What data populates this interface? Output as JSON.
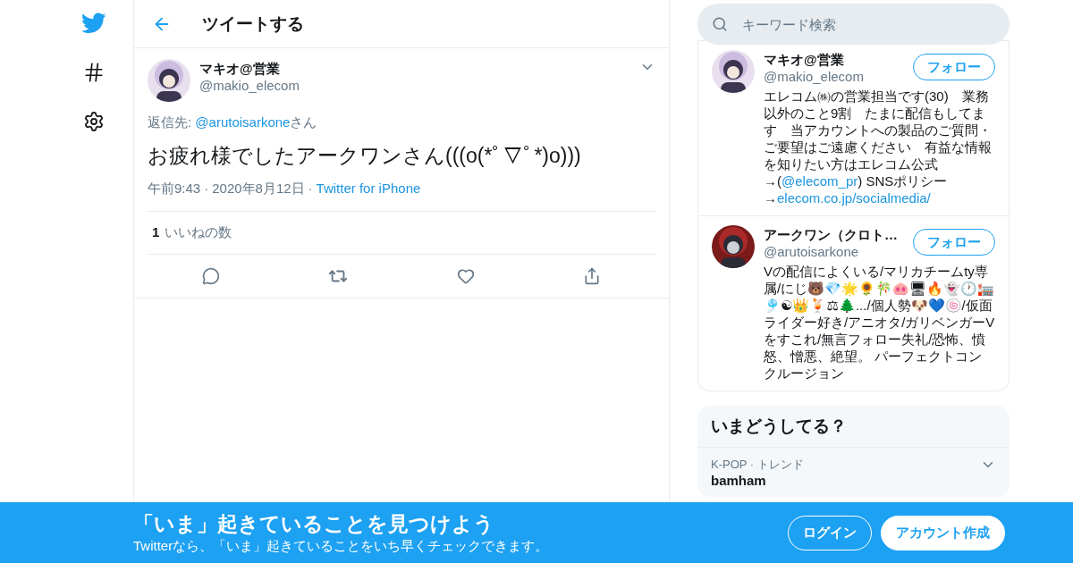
{
  "nav": {
    "items": [
      {
        "kind": "logo"
      },
      {
        "kind": "explore"
      },
      {
        "kind": "settings"
      }
    ]
  },
  "header": {
    "title": "ツイートする"
  },
  "tweet": {
    "name": "マキオ@営業",
    "handle": "@makio_elecom",
    "reply_label": "返信先:",
    "reply_to": "@arutoisarkone",
    "reply_suffix": "さん",
    "text": "お疲れ様でしたアークワンさん(((o(*ﾟ▽ﾟ*)o)))",
    "time": "午前9:43",
    "date": "2020年8月12日",
    "separator": "·",
    "source": "Twitter for iPhone",
    "likes_count": "1",
    "likes_label": "いいねの数"
  },
  "search": {
    "placeholder": "キーワード検索"
  },
  "users": [
    {
      "name": "マキオ@営業",
      "handle": "@makio_elecom",
      "follow": "フォロー",
      "bio": [
        {
          "t": "エレコム㈱の営業担当です(30)　業務以外のこと9割　たまに配信もしてます　当アカウントへの製品のご質問・ご要望はご遠慮ください　有益な情報を知りたい方はエレコム公式→("
        },
        {
          "t": "@elecom_pr",
          "link": true
        },
        {
          "t": ") SNSポリシー→"
        },
        {
          "t": "elecom.co.jp/socialmedia/",
          "link": true
        }
      ]
    },
    {
      "name": "アークワン（クロト…",
      "handle": "@arutoisarkone",
      "follow": "フォロー",
      "bio": [
        {
          "t": "Vの配信によくいる/マリカチームty専属/にじ🐻💎🌟🌻🎋🐽🖥🔥👻🕐🏣🎐☯👑🍹⚖🌲.../個人勢🐶💙🍥/仮面ライダー好き/アニオタ/ガリベンガーVをすこれ/無言フォロー失礼/恐怖、憤怒、憎悪、絶望。 パーフェクトコンクルージョン"
        }
      ]
    }
  ],
  "trends": {
    "title": "いまどうしてる？",
    "items": [
      {
        "context": "K-POP · トレンド",
        "name": "bamham"
      }
    ]
  },
  "banner": {
    "title": "「いま」起きていることを見つけよう",
    "subtitle": "Twitterなら、「いま」起きていることをいち早くチェックできます。",
    "buttons": [
      {
        "label": "ログイン",
        "kind": "outline"
      },
      {
        "label": "アカウント作成",
        "kind": "solid"
      }
    ]
  }
}
